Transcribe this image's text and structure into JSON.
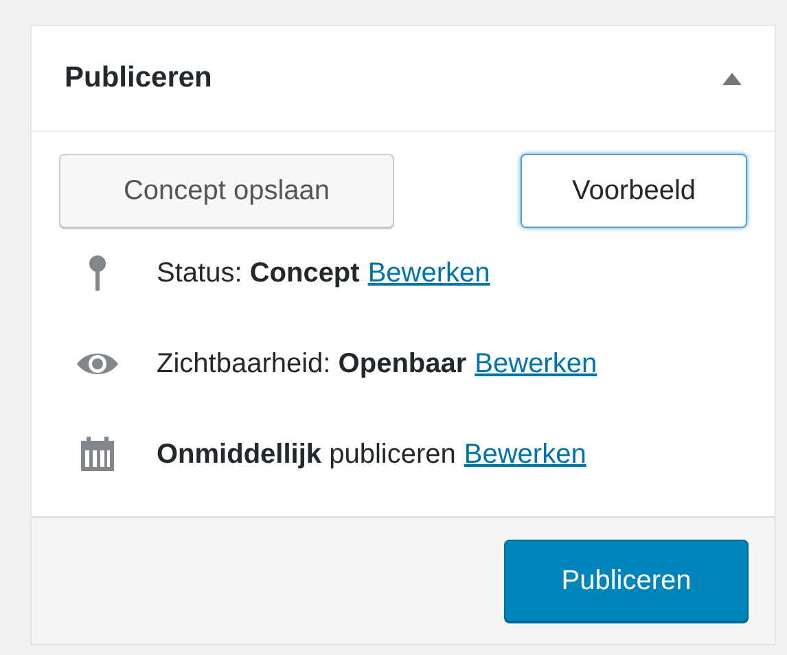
{
  "panel": {
    "title": "Publiceren"
  },
  "actions": [
    {
      "label": "Concept opslaan",
      "kind": "secondary"
    },
    {
      "label": "Voorbeeld",
      "kind": "focused"
    }
  ],
  "rows": [
    {
      "kind": "status",
      "text": "Status: **Concept**",
      "link": "Bewerken"
    },
    {
      "kind": "visibility",
      "text": "Zichtbaarheid: **Openbaar**",
      "link": "Bewerken"
    },
    {
      "kind": "schedule",
      "text": "**Onmiddellijk** publiceren",
      "link": "Bewerken"
    }
  ],
  "footer": {
    "button": "Publiceren"
  }
}
